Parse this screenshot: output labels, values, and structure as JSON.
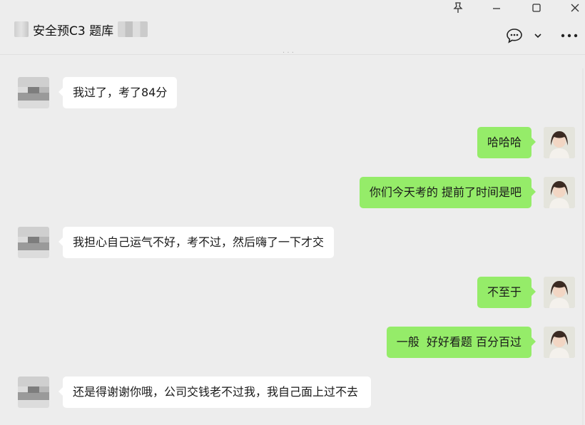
{
  "window": {
    "pin_icon": "pin-icon",
    "minimize_icon": "minimize-icon",
    "maximize_icon": "maximize-icon",
    "close_icon": "close-icon"
  },
  "header": {
    "title": "安全预C3 题库",
    "chat_icon": "chat-bubble-icon",
    "dropdown_icon": "chevron-down-icon",
    "more_icon": "more-dots-icon"
  },
  "messages": [
    {
      "from": "other",
      "text": "我过了，考了84分"
    },
    {
      "from": "self",
      "text": "哈哈哈"
    },
    {
      "from": "self",
      "text": "你们今天考的 提前了时间是吧"
    },
    {
      "from": "other",
      "text": "我担心自己运气不好，考不过，然后嗨了一下才交"
    },
    {
      "from": "self",
      "text": "不至于"
    },
    {
      "from": "self",
      "text": "一般  好好看题 百分百过"
    },
    {
      "from": "other",
      "text": "还是得谢谢你哦，公司交钱老不过我，我自己面上过不去"
    }
  ],
  "colors": {
    "background": "#ededed",
    "self_bubble": "#95ec69",
    "other_bubble": "#ffffff"
  }
}
